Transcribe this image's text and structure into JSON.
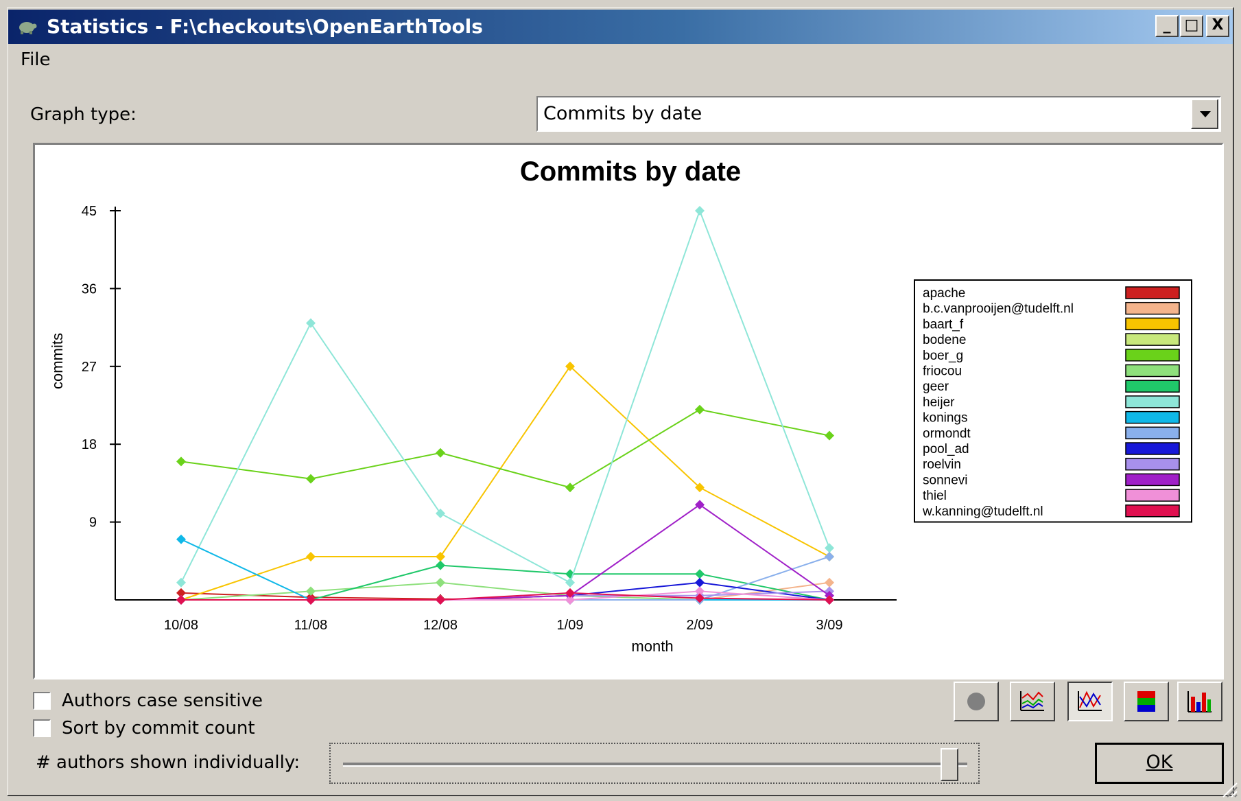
{
  "window": {
    "title": "Statistics - F:\\checkouts\\OpenEarthTools",
    "min": "_",
    "max": "□",
    "close": "X"
  },
  "menu": {
    "file": "File"
  },
  "graph_type": {
    "label": "Graph type:",
    "value": "Commits by date"
  },
  "options": {
    "case_sensitive": "Authors case sensitive",
    "sort_by_count": "Sort by commit count",
    "authors_shown": "# authors shown individually:"
  },
  "ok_label": "OK",
  "slider": {
    "value_fraction": 0.99
  },
  "chart_data": {
    "type": "line",
    "title": "Commits by date",
    "xlabel": "month",
    "ylabel": "commits",
    "categories": [
      "10/08",
      "11/08",
      "12/08",
      "1/09",
      "2/09",
      "3/09"
    ],
    "yticks": [
      9,
      18,
      27,
      36,
      45
    ],
    "ylim": [
      0,
      45
    ],
    "legend_position": "right",
    "series": [
      {
        "name": "apache",
        "color": "#cc2020",
        "values": [
          0.8,
          0.3,
          0.1,
          0,
          0,
          0
        ]
      },
      {
        "name": "b.c.vanprooijen@tudelft.nl",
        "color": "#f4b48c",
        "values": [
          0,
          0,
          0,
          0,
          0,
          2
        ]
      },
      {
        "name": "baart_f",
        "color": "#f8c400",
        "values": [
          0,
          5,
          5,
          27,
          13,
          5
        ]
      },
      {
        "name": "bodene",
        "color": "#c8e87c",
        "values": [
          0,
          0,
          0,
          0,
          0,
          0
        ]
      },
      {
        "name": "boer_g",
        "color": "#6ad21a",
        "values": [
          16,
          14,
          17,
          13,
          22,
          19
        ]
      },
      {
        "name": "friocou",
        "color": "#8ee07c",
        "values": [
          0,
          1,
          2,
          0.5,
          0,
          0
        ]
      },
      {
        "name": "geer",
        "color": "#20c86a",
        "values": [
          0,
          0,
          4,
          3,
          3,
          0
        ]
      },
      {
        "name": "heijer",
        "color": "#8ee6d8",
        "values": [
          2,
          32,
          10,
          2,
          45,
          6
        ]
      },
      {
        "name": "konings",
        "color": "#10b8e8",
        "values": [
          7,
          0,
          0,
          0,
          0,
          0
        ]
      },
      {
        "name": "ormondt",
        "color": "#8ab0ec",
        "values": [
          0,
          0,
          0,
          0,
          0,
          5
        ]
      },
      {
        "name": "pool_ad",
        "color": "#1818d8",
        "values": [
          0,
          0,
          0,
          0.5,
          2,
          0
        ]
      },
      {
        "name": "roelvin",
        "color": "#a890ec",
        "values": [
          0,
          0,
          0,
          0.5,
          0.5,
          1
        ]
      },
      {
        "name": "sonnevi",
        "color": "#a020c8",
        "values": [
          0,
          0,
          0,
          0.5,
          11,
          0.5
        ]
      },
      {
        "name": "thiel",
        "color": "#f090d8",
        "values": [
          0,
          0,
          0,
          0,
          1,
          0
        ]
      },
      {
        "name": "w.kanning@tudelft.nl",
        "color": "#e01050",
        "values": [
          0,
          0,
          0,
          0.8,
          0.2,
          0
        ]
      }
    ]
  }
}
